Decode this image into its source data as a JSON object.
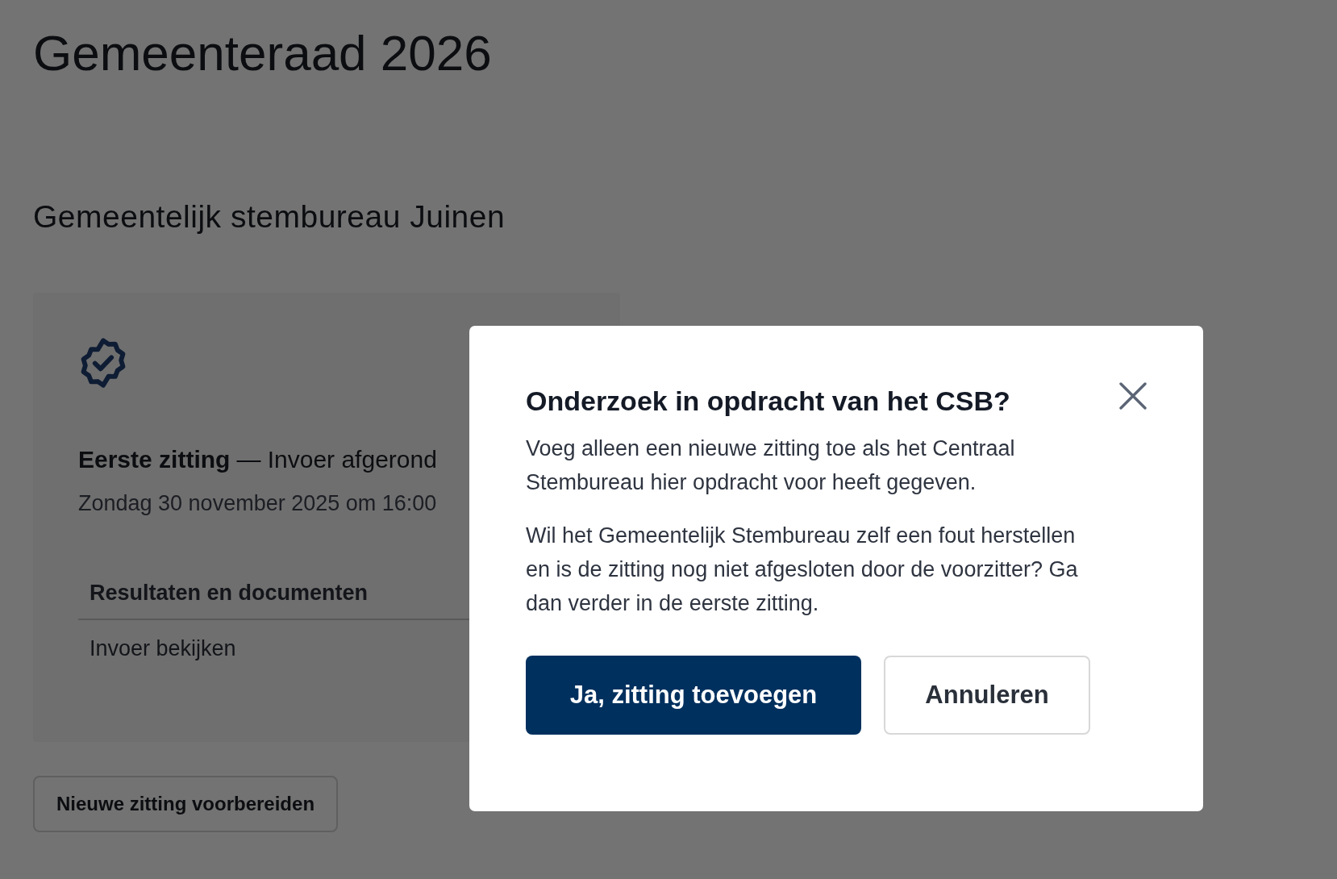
{
  "page_title": "Gemeenteraad 2026",
  "section_title": "Gemeentelijk stembureau Juinen",
  "session_card": {
    "session_name": "Eerste zitting",
    "status": "— Invoer afgerond",
    "date": "Zondag 30 november 2025 om 16:00",
    "table_header": "Resultaten en documenten",
    "link": "Invoer bekijken"
  },
  "new_session_button": "Nieuwe zitting voorbereiden",
  "dialog": {
    "title": "Onderzoek in opdracht van het CSB?",
    "paragraphs": [
      "Voeg alleen een nieuwe zitting toe als het Centraal Stembureau hier opdracht voor heeft gegeven.",
      "Wil het Gemeentelijk Stembureau zelf een fout herstellen en is de zitting nog niet afgesloten door de voorzitter? Ga dan verder in de eerste zitting."
    ],
    "buttons": [
      {
        "label": "Ja, zitting toevoegen",
        "kind": "primary"
      },
      {
        "label": "Annuleren",
        "kind": "secondary"
      }
    ]
  }
}
